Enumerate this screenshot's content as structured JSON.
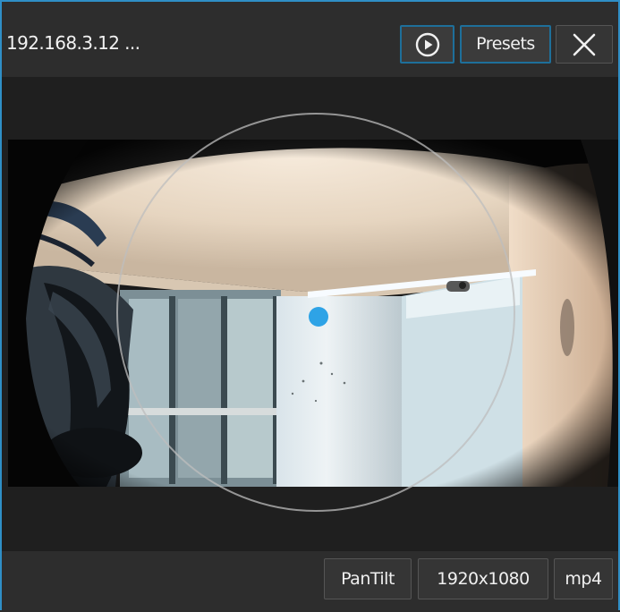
{
  "header": {
    "title": "192.168.3.12 ...",
    "play_icon": "play-circle-icon",
    "presets_label": "Presets",
    "close_icon": "close-x-icon"
  },
  "footer": {
    "pantilt_label": "PanTilt",
    "resolution_label": "1920x1080",
    "format_label": "mp4"
  },
  "colors": {
    "accent": "#2f8fc6",
    "ptz_dot": "#2ea3e6",
    "background": "#2b2b2b"
  }
}
